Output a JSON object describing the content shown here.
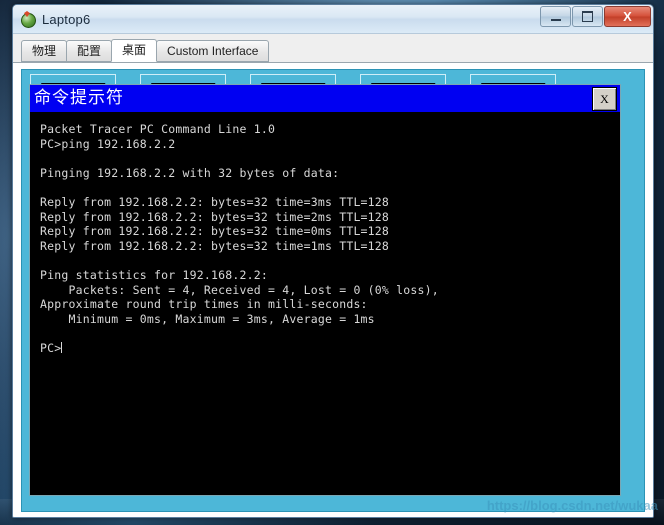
{
  "window": {
    "title": "Laptop6",
    "icon": "packet-tracer-device-icon",
    "controls": {
      "minimize_label": "–",
      "maximize_label": "□",
      "close_label": "X"
    }
  },
  "tabs": [
    {
      "label": "物理",
      "active": false
    },
    {
      "label": "配置",
      "active": false
    },
    {
      "label": "桌面",
      "active": true
    },
    {
      "label": "Custom Interface",
      "active": false
    }
  ],
  "desktop": {
    "background_color": "#4db7d8",
    "icons": [
      {
        "name": "desktop-icon-1"
      },
      {
        "name": "desktop-icon-2"
      },
      {
        "name": "desktop-icon-3"
      },
      {
        "name": "desktop-icon-4"
      },
      {
        "name": "desktop-icon-5"
      }
    ]
  },
  "cmd_window": {
    "title": "命令提示符",
    "title_bar_color": "#0000f2",
    "close_label": "X",
    "output": "Packet Tracer PC Command Line 1.0\nPC>ping 192.168.2.2\n\nPinging 192.168.2.2 with 32 bytes of data:\n\nReply from 192.168.2.2: bytes=32 time=3ms TTL=128\nReply from 192.168.2.2: bytes=32 time=2ms TTL=128\nReply from 192.168.2.2: bytes=32 time=0ms TTL=128\nReply from 192.168.2.2: bytes=32 time=1ms TTL=128\n\nPing statistics for 192.168.2.2:\n    Packets: Sent = 4, Received = 4, Lost = 0 (0% loss),\nApproximate round trip times in milli-seconds:\n    Minimum = 0ms, Maximum = 3ms, Average = 1ms\n\nPC>"
  },
  "watermark": {
    "text": "https://blog.csdn.net/wukaa"
  }
}
